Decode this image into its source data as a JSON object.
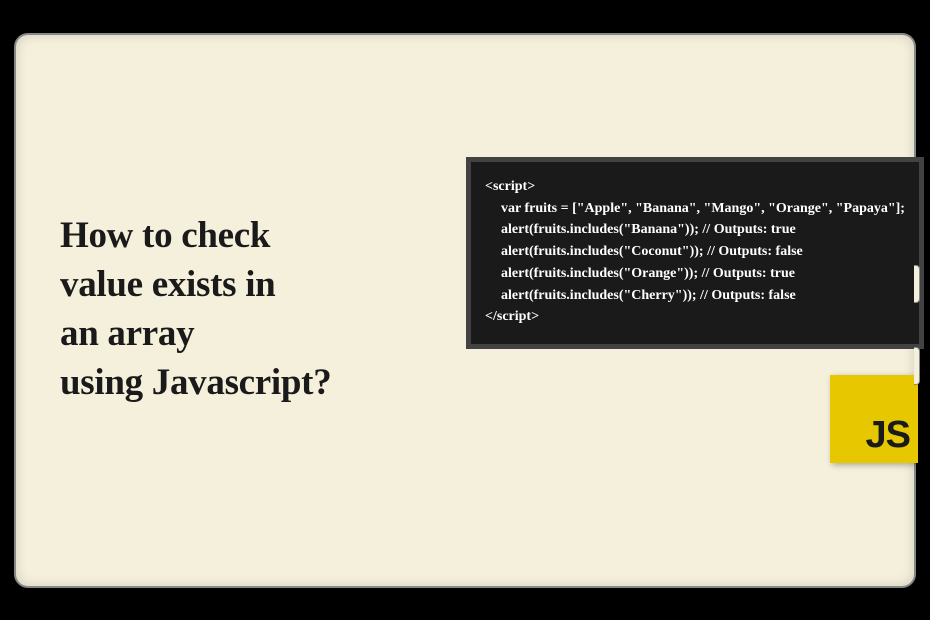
{
  "title": {
    "line1": "How to check",
    "line2": "value exists in",
    "line3": "an array",
    "line4": "using Javascript?"
  },
  "code": {
    "open": "<script>",
    "l1": "var fruits = [\"Apple\", \"Banana\", \"Mango\", \"Orange\", \"Papaya\"];",
    "l2": "alert(fruits.includes(\"Banana\")); // Outputs: true",
    "l3": "alert(fruits.includes(\"Coconut\")); // Outputs: false",
    "l4": "alert(fruits.includes(\"Orange\")); // Outputs: true",
    "l5": "alert(fruits.includes(\"Cherry\")); // Outputs: false",
    "close": "</script>"
  },
  "logo": {
    "text": "JS"
  }
}
